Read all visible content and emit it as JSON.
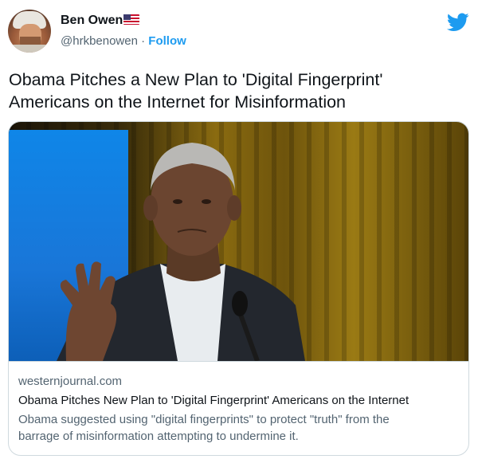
{
  "author": {
    "name": "Ben Owen",
    "handle": "@hrkbenowen",
    "separator": "·",
    "follow_label": "Follow",
    "flag_icon": "us-flag-icon"
  },
  "platform_icon": "twitter-bird-icon",
  "colors": {
    "accent": "#1d9bf0",
    "secondary_text": "#536471",
    "primary_text": "#0f1419",
    "border": "#cfd9de"
  },
  "tweet": {
    "text_line1": "Obama Pitches a New Plan to 'Digital Fingerprint'",
    "text_line2": "Americans on the Internet for Misinformation"
  },
  "card": {
    "domain": "westernjournal.com",
    "title": "Obama Pitches New Plan to 'Digital Fingerprint' Americans on the Internet",
    "description_line1": "Obama suggested using \"digital fingerprints\" to protect \"truth\" from the",
    "description_line2": "barrage of misinformation attempting to undermine it."
  }
}
